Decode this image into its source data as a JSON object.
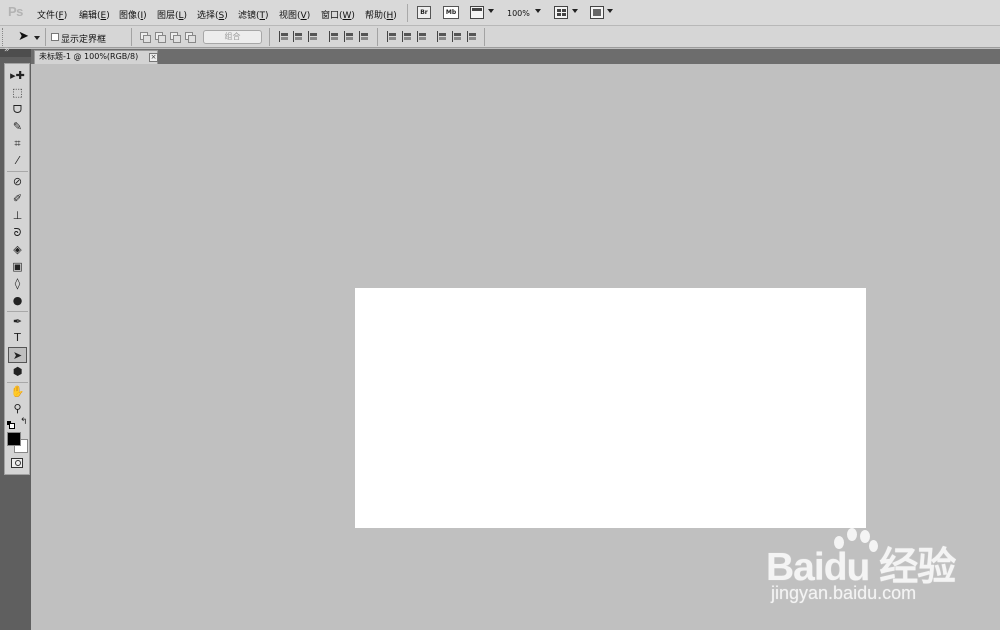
{
  "app": {
    "logo": "Ps"
  },
  "menu": {
    "items": [
      {
        "label": "文件(",
        "key": "F",
        "tail": ")"
      },
      {
        "label": "编辑(",
        "key": "E",
        "tail": ")"
      },
      {
        "label": "图像(",
        "key": "I",
        "tail": ")"
      },
      {
        "label": "图层(",
        "key": "L",
        "tail": ")"
      },
      {
        "label": "选择(",
        "key": "S",
        "tail": ")"
      },
      {
        "label": "滤镜(",
        "key": "T",
        "tail": ")"
      },
      {
        "label": "视图(",
        "key": "V",
        "tail": ")"
      },
      {
        "label": "窗口(",
        "key": "W",
        "tail": ")"
      },
      {
        "label": "帮助(",
        "key": "H",
        "tail": ")"
      }
    ],
    "bridge_label": "Br",
    "minibridge_label": "Mb",
    "zoom": "100%"
  },
  "options": {
    "show_transform_controls": "显示定界框",
    "combine_label": "组合"
  },
  "document": {
    "tab_title": "未标题-1 @ 100%(RGB/8)",
    "close_glyph": "×"
  },
  "tools": [
    {
      "name": "move-tool",
      "glyph": "▸✚"
    },
    {
      "name": "marquee-tool",
      "glyph": "⬚"
    },
    {
      "name": "lasso-tool",
      "glyph": "ᗜ"
    },
    {
      "name": "quick-select-tool",
      "glyph": "✎"
    },
    {
      "name": "crop-tool",
      "glyph": "⌗"
    },
    {
      "name": "eyedropper-tool",
      "glyph": "⁄"
    },
    {
      "name": "healing-tool",
      "glyph": "⊘"
    },
    {
      "name": "brush-tool",
      "glyph": "✐"
    },
    {
      "name": "stamp-tool",
      "glyph": "⊥"
    },
    {
      "name": "history-brush-tool",
      "glyph": "ᘐ"
    },
    {
      "name": "eraser-tool",
      "glyph": "◈"
    },
    {
      "name": "gradient-tool",
      "glyph": "▣"
    },
    {
      "name": "blur-tool",
      "glyph": "◊"
    },
    {
      "name": "dodge-tool",
      "glyph": "●"
    },
    {
      "name": "pen-tool",
      "glyph": "✒"
    },
    {
      "name": "type-tool",
      "glyph": "T"
    },
    {
      "name": "path-select-tool",
      "glyph": "➤"
    },
    {
      "name": "shape-tool",
      "glyph": "⬢"
    },
    {
      "name": "hand-tool",
      "glyph": "✋"
    },
    {
      "name": "zoom-tool",
      "glyph": "⚲"
    }
  ],
  "watermark": {
    "main": "Bai",
    "du": "du",
    "cn": "经验",
    "sub": "jingyan.baidu.com"
  },
  "colors": {
    "workspace": "#c0c0c0",
    "canvas": "#ffffff",
    "foreground": "#000000",
    "background": "#ffffff"
  }
}
